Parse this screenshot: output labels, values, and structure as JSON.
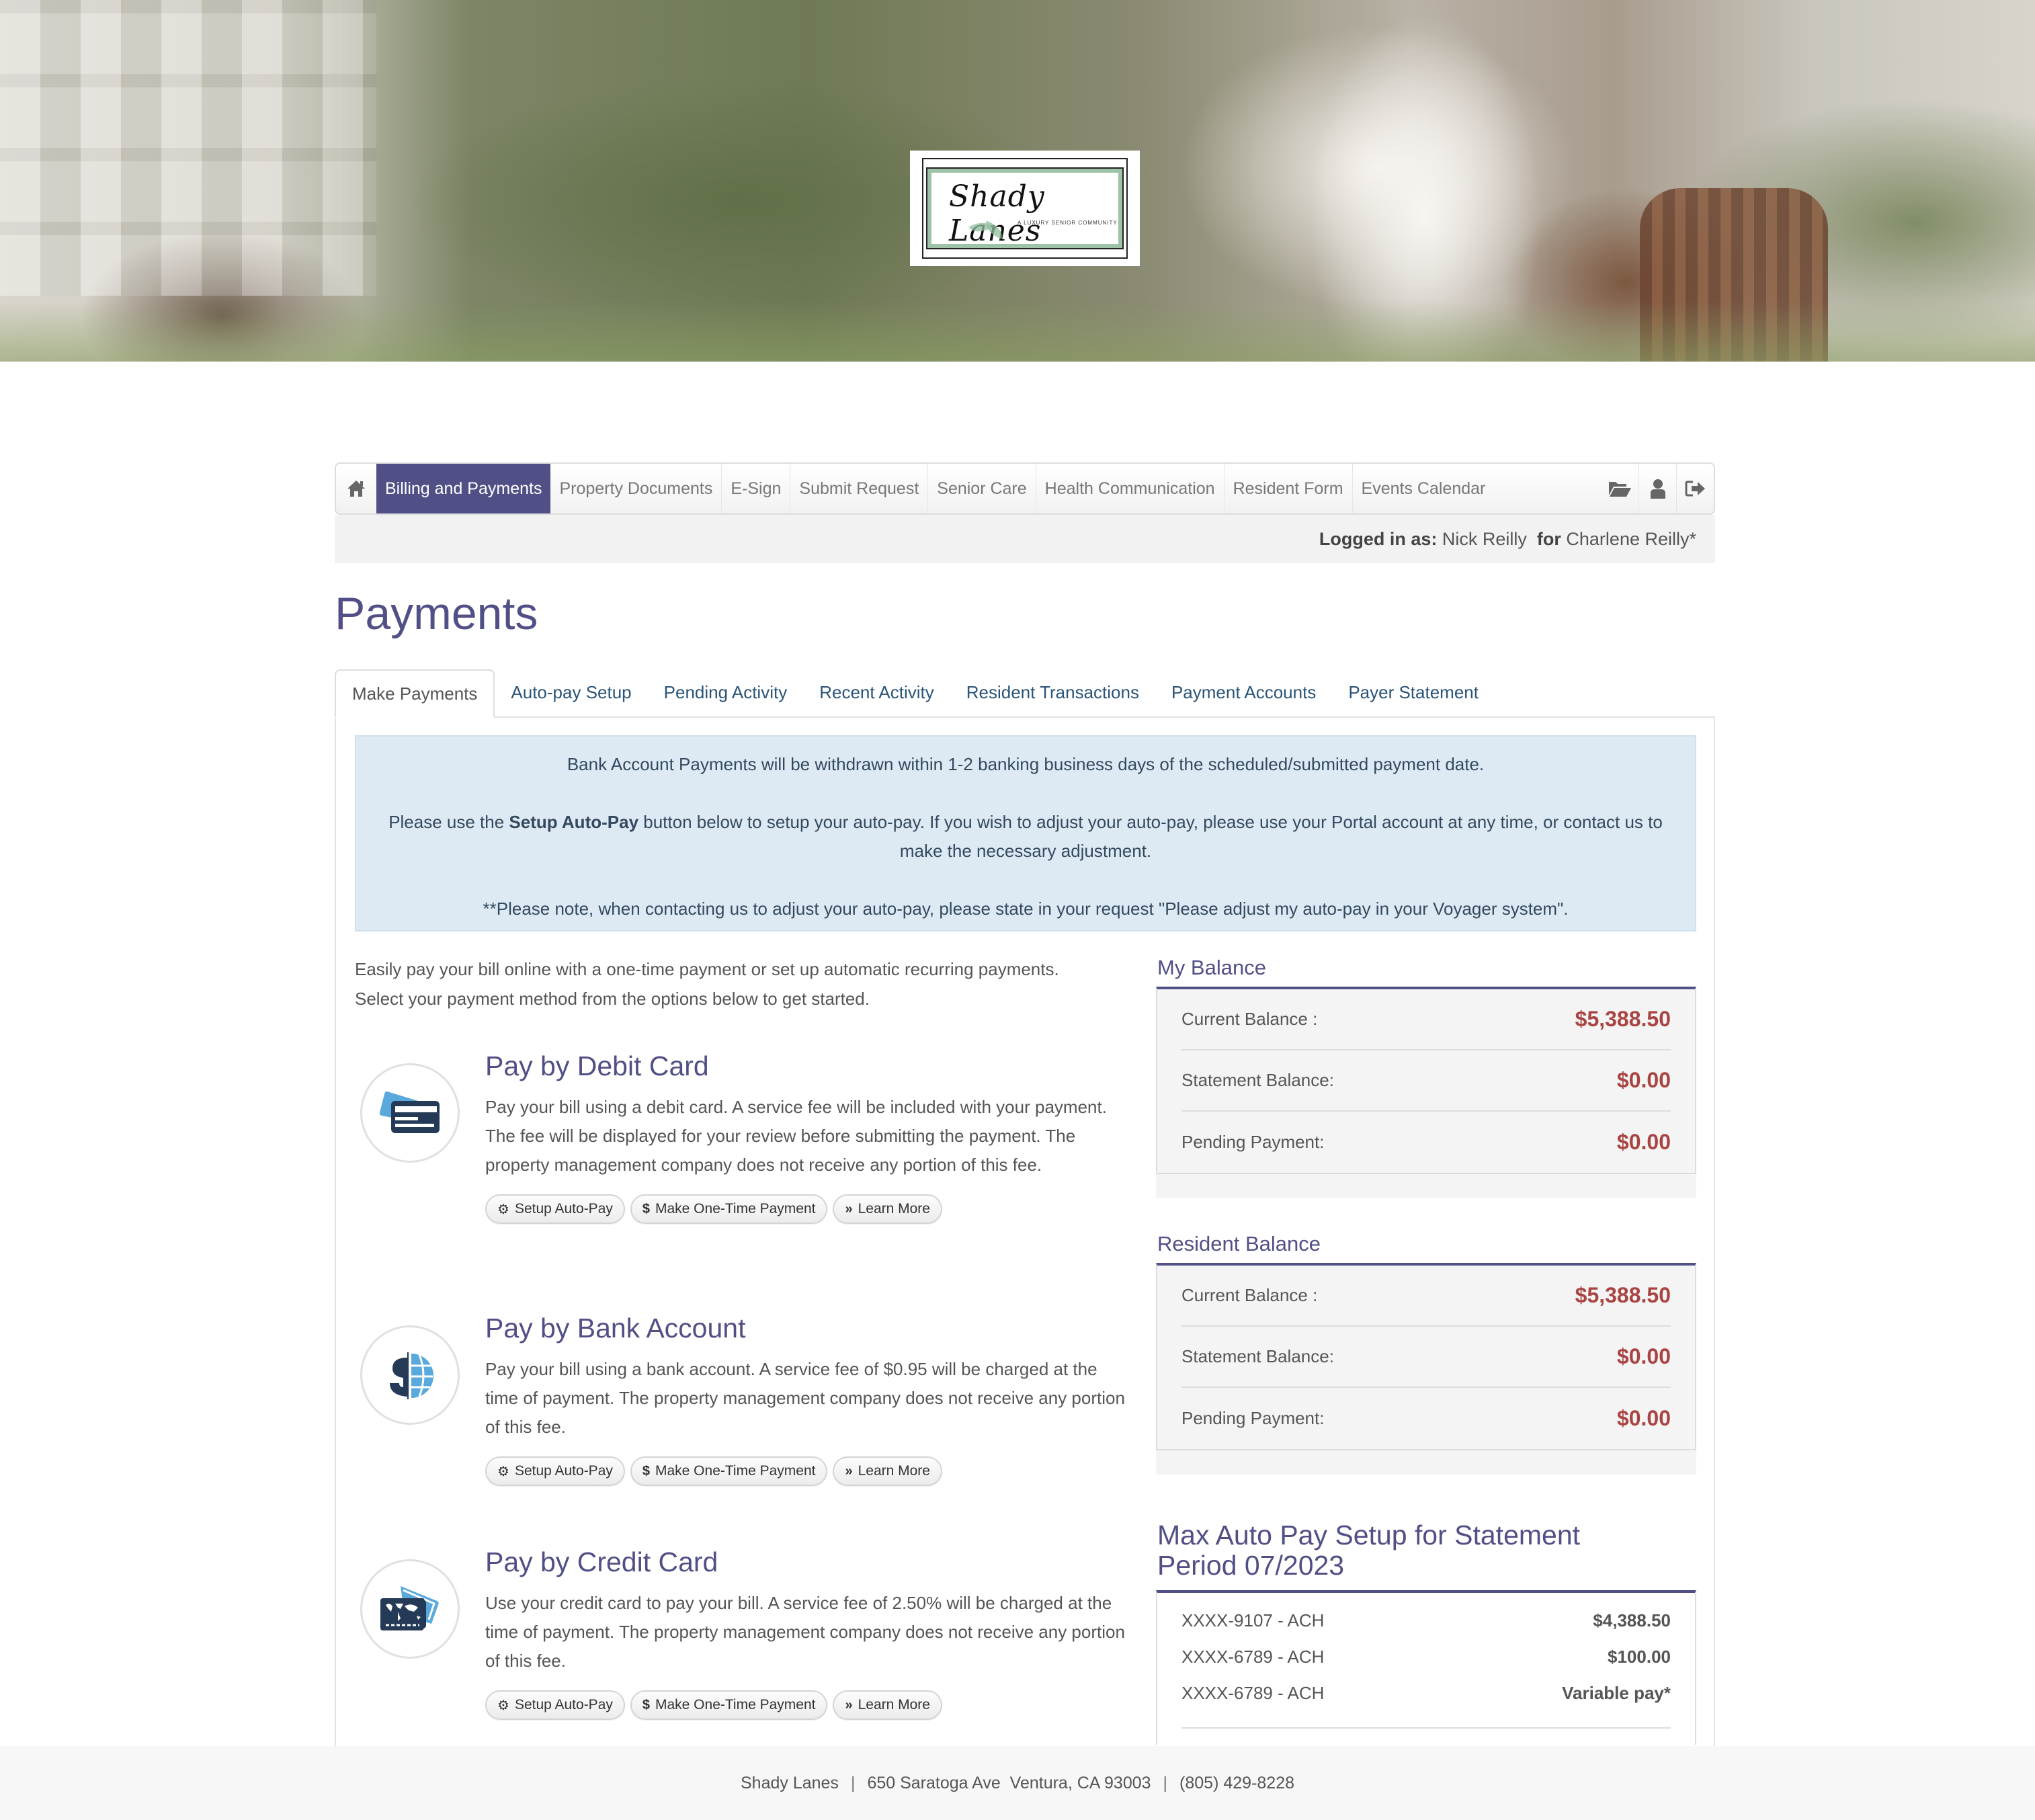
{
  "brand": {
    "logo_script": "Shady Lanes",
    "logo_tagline": "A LUXURY SENIOR COMMUNITY",
    "accent_color": "#505086",
    "amount_color": "#a94442"
  },
  "nav": {
    "home_icon": "home-icon",
    "items": [
      {
        "label": "Billing and Payments",
        "active": true
      },
      {
        "label": "Property Documents"
      },
      {
        "label": "E-Sign"
      },
      {
        "label": "Submit Request"
      },
      {
        "label": "Senior Care"
      },
      {
        "label": "Health Communication"
      },
      {
        "label": "Resident Form"
      },
      {
        "label": "Events Calendar"
      }
    ],
    "right_icons": [
      "folder-open-icon",
      "user-icon",
      "sign-out-icon"
    ]
  },
  "session": {
    "logged_in_label": "Logged in as:",
    "user": "Nick Reilly",
    "for_label": "for",
    "resident": "Charlene Reilly*"
  },
  "page": {
    "title": "Payments"
  },
  "tabs": [
    {
      "label": "Make Payments",
      "active": true
    },
    {
      "label": "Auto-pay Setup"
    },
    {
      "label": "Pending Activity"
    },
    {
      "label": "Recent Activity"
    },
    {
      "label": "Resident Transactions"
    },
    {
      "label": "Payment Accounts"
    },
    {
      "label": "Payer Statement"
    }
  ],
  "notice": {
    "line1": "Bank Account Payments will be withdrawn within 1-2 banking business days of the scheduled/submitted payment date.",
    "line2_prefix": "Please use the ",
    "line2_bold": "Setup Auto-Pay",
    "line2_suffix": " button below to setup your auto-pay. If you wish to adjust your auto-pay, please use your Portal account at any time, or contact us to make the necessary adjustment.",
    "line3": "**Please note, when contacting us to adjust your auto-pay, please state in your request \"Please adjust my auto-pay in your Voyager system\"."
  },
  "intro": {
    "line1": "Easily pay your bill online with a one-time payment or set up automatic recurring payments.",
    "line2": "Select your payment method from the options below to get started."
  },
  "methods": [
    {
      "icon": "debit-card-icon",
      "title": "Pay by Debit Card",
      "description": "Pay your bill using a debit card. A service fee will be included with your payment. The fee will be displayed for your review before submitting the payment. The property management company does not receive any portion of this fee."
    },
    {
      "icon": "bank-account-icon",
      "title": "Pay by Bank Account",
      "description": "Pay your bill using a bank account. A service fee of $0.95 will be charged at the time of payment. The property management company does not receive any portion of this fee."
    },
    {
      "icon": "credit-card-icon",
      "title": "Pay by Credit Card",
      "description": "Use your credit card to pay your bill. A service fee of 2.50% will be charged at the time of payment. The property management company does not receive any portion of this fee."
    }
  ],
  "method_buttons": {
    "setup_autopay": "Setup Auto-Pay",
    "one_time": "Make One-Time Payment",
    "learn_more": "Learn More"
  },
  "my_balance": {
    "title": "My Balance",
    "rows": [
      {
        "label": "Current Balance :",
        "value": "$5,388.50"
      },
      {
        "label": "Statement Balance:",
        "value": "$0.00"
      },
      {
        "label": "Pending Payment:",
        "value": "$0.00"
      }
    ]
  },
  "resident_balance": {
    "title": "Resident Balance",
    "rows": [
      {
        "label": "Current Balance :",
        "value": "$5,388.50"
      },
      {
        "label": "Statement Balance:",
        "value": "$0.00"
      },
      {
        "label": "Pending Payment:",
        "value": "$0.00"
      }
    ]
  },
  "max_autopay": {
    "title": "Max Auto Pay Setup for Statement Period 07/2023",
    "rows": [
      {
        "account": "XXXX-9107 - ACH",
        "amount": "$4,388.50"
      },
      {
        "account": "XXXX-6789 - ACH",
        "amount": "$100.00"
      },
      {
        "account": "XXXX-6789 - ACH",
        "amount": "Variable pay*"
      }
    ]
  },
  "footer": {
    "name": "Shady Lanes",
    "address": "650 Saratoga Ave  Ventura, CA 93003",
    "phone": "(805) 429-8228",
    "separator": "|"
  }
}
